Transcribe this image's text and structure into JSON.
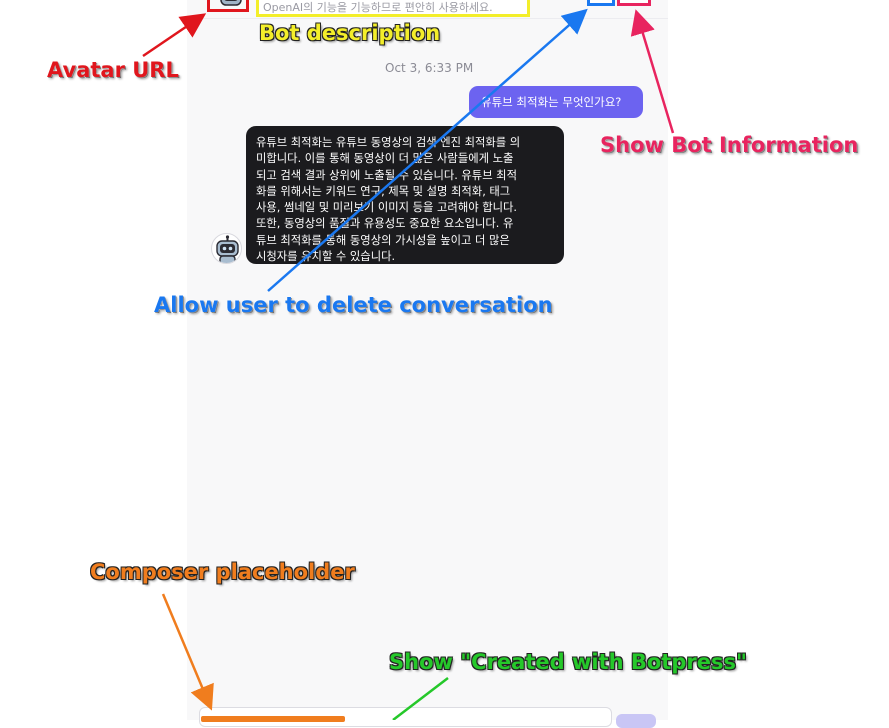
{
  "header": {
    "description_text": "OpenAI의 기능을 기능하므로 편안히 사용하세요.",
    "icons": [
      "bot-avatar-icon",
      "delete-conversation-icon",
      "bot-info-icon"
    ]
  },
  "conversation": {
    "timestamp": "Oct 3, 6:33 PM",
    "user_message": "유튜브 최적화는 무엇인가요?",
    "bot_message_lines": [
      "유튜브 최적화는 유튜브 동영상의 검색 엔진 최적화를 의",
      "미합니다. 이를 통해 동영상이 더 많은 사람들에게 노출",
      "되고 검색 결과 상위에 노출될 수 있습니다. 유튜브 최적",
      "화를 위해서는 키워드 연구, 제목 및 설명 최적화, 태그",
      "사용, 썸네일 및 미리보기 이미지 등을 고려해야 합니다.",
      "또한, 동영상의 품질과 유용성도 중요한 요소입니다. 유",
      "튜브 최적화를 통해 동영상의 가시성을 높이고 더 많은",
      "시청자를 유치할 수 있습니다."
    ]
  },
  "annotations": {
    "avatar_url": "Avatar URL",
    "bot_description": "Bot description",
    "show_bot_information": "Show Bot Information",
    "allow_delete": "Allow user to delete conversation",
    "composer_placeholder": "Composer placeholder",
    "show_created_with": "Show \"Created with Botpress\""
  },
  "colors": {
    "red": "#e0161d",
    "yellow": "#f3ee2a",
    "pink": "#e8245f",
    "blue": "#1a78f0",
    "orange": "#f07d1e",
    "green": "#25c82a",
    "user_bubble": "#6c63f0",
    "bot_bubble": "#1b1b1e"
  }
}
